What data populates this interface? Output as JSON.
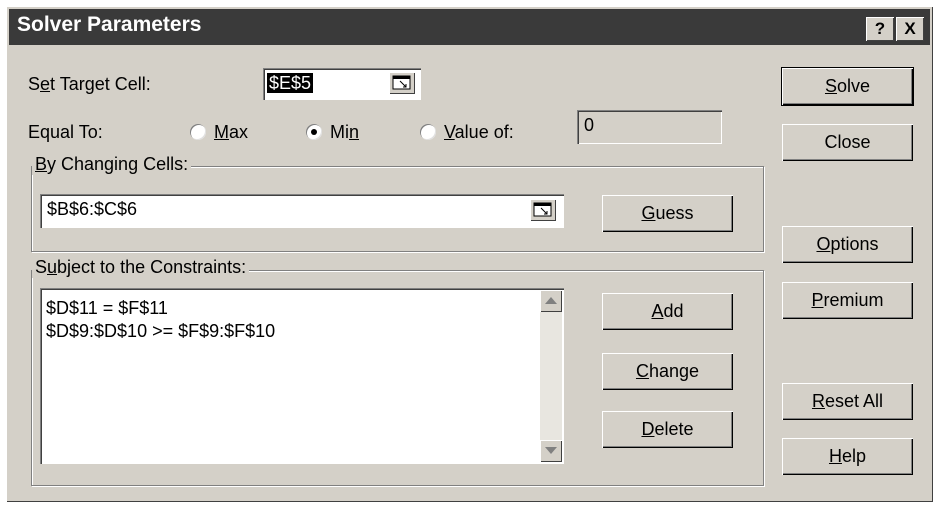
{
  "window": {
    "title": "Solver Parameters",
    "help_label": "?",
    "close_label": "X"
  },
  "target": {
    "label_pre": "S",
    "label_u": "e",
    "label_post": "t Target Cell:",
    "value": "$E$5"
  },
  "equal_to": {
    "label": "Equal To:",
    "max_pre": "",
    "max_u": "M",
    "max_post": "ax",
    "min_pre": "Mi",
    "min_u": "n",
    "min_post": "",
    "valueof_pre": "",
    "valueof_u": "V",
    "valueof_post": "alue of:",
    "selected": "Min",
    "value": "0"
  },
  "changing": {
    "legend_pre": "",
    "legend_u": "B",
    "legend_post": "y Changing Cells:",
    "value": "$B$6:$C$6"
  },
  "constraints": {
    "legend_pre": "S",
    "legend_u": "u",
    "legend_post": "bject to the Constraints:",
    "items": [
      "$D$11 = $F$11",
      "$D$9:$D$10 >= $F$9:$F$10"
    ]
  },
  "buttons": {
    "solve": {
      "u": "S",
      "rest": "olve"
    },
    "close": "Close",
    "guess": {
      "u": "G",
      "rest": "uess"
    },
    "options": {
      "u": "O",
      "rest": "ptions"
    },
    "premium": {
      "u": "P",
      "rest": "remium"
    },
    "add": {
      "u": "A",
      "rest": "dd"
    },
    "change": {
      "u": "C",
      "rest": "hange"
    },
    "delete": {
      "u": "D",
      "rest": "elete"
    },
    "reset": {
      "u": "R",
      "rest": "eset All"
    },
    "help": {
      "u": "H",
      "rest": "elp"
    }
  }
}
